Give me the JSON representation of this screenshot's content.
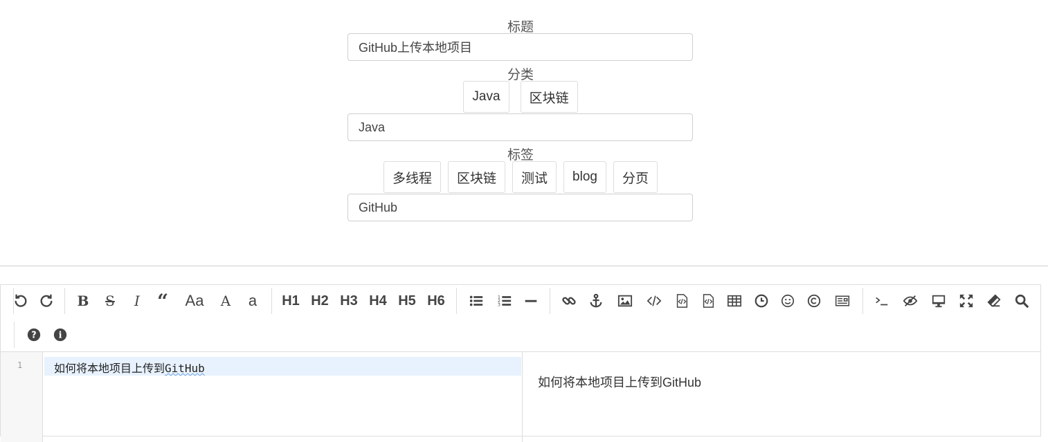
{
  "form": {
    "title_label": "标题",
    "title_value": "GitHub上传本地项目",
    "category_label": "分类",
    "category_chips": [
      "Java",
      "区块链"
    ],
    "category_value": "Java",
    "tags_label": "标签",
    "tag_chips": [
      "多线程",
      "区块链",
      "测试",
      "blog",
      "分页"
    ],
    "tags_value": "GitHub"
  },
  "toolbar": {
    "heading_buttons": [
      "H1",
      "H2",
      "H3",
      "H4",
      "H5",
      "H6"
    ],
    "icons": [
      "undo-icon",
      "redo-icon",
      "bold-icon",
      "strikethrough-icon",
      "italic-icon",
      "quote-icon",
      "uppercase-icon",
      "title-case-icon",
      "lowercase-icon",
      "h1",
      "h2",
      "h3",
      "h4",
      "h5",
      "h6",
      "unordered-list-icon",
      "ordered-list-icon",
      "horizontal-rule-icon",
      "link-icon",
      "anchor-icon",
      "image-icon",
      "inline-code-icon",
      "code-block-icon",
      "preformatted-icon",
      "table-icon",
      "datetime-icon",
      "emoji-icon",
      "html-entities-icon",
      "pagebreak-icon",
      "goto-line-icon",
      "watch-toggle-icon",
      "preview-icon",
      "fullscreen-icon",
      "clear-icon",
      "search-icon",
      "help-icon",
      "info-icon"
    ]
  },
  "editor": {
    "line_number": "1",
    "code_before": "如何将本地项目上传到",
    "code_spell": "GitHub",
    "preview_text": "如何将本地项目上传到GitHub"
  }
}
